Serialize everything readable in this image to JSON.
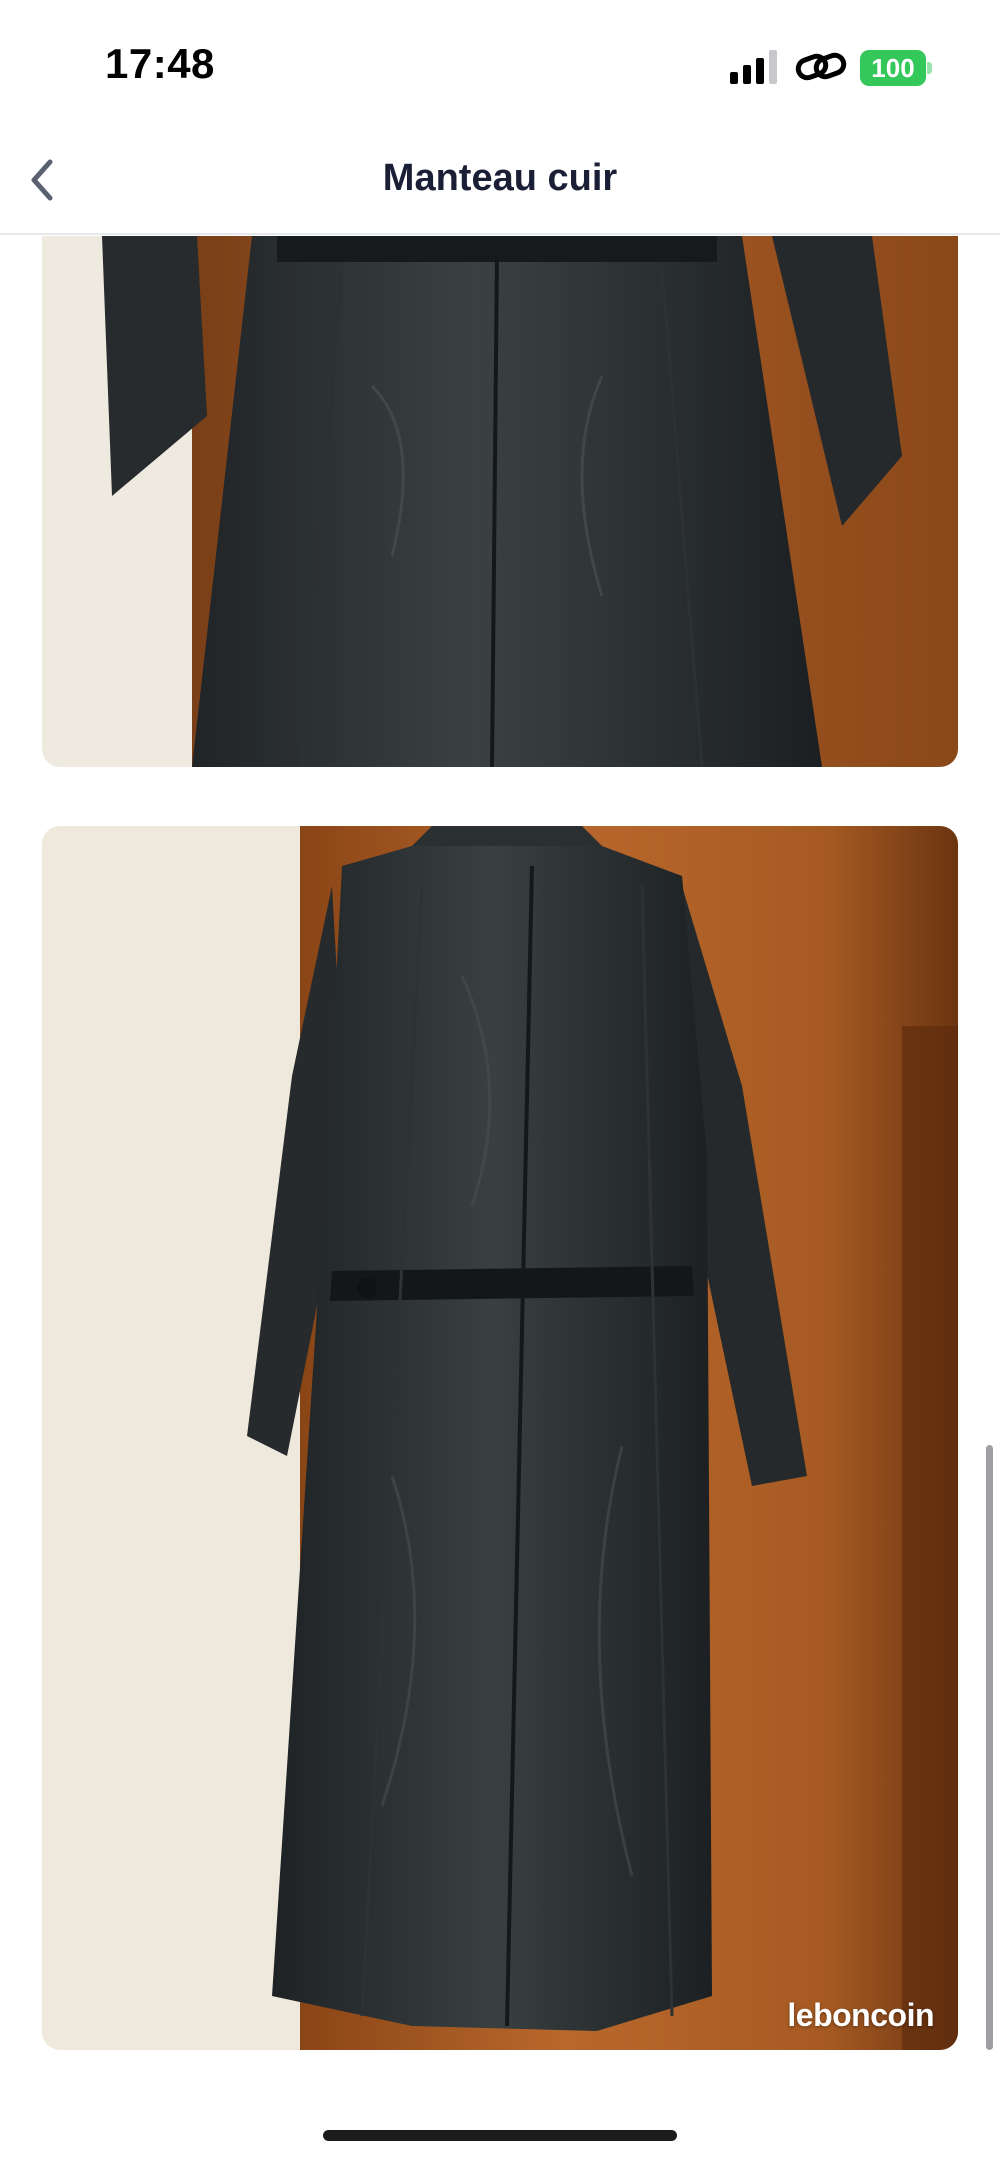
{
  "status_bar": {
    "time": "17:48",
    "battery": "100",
    "battery_color": "#34c759",
    "icons": [
      "signal-icon",
      "chain-link-icon",
      "battery-icon"
    ]
  },
  "header": {
    "title": "Manteau cuir",
    "back_icon": "chevron-left-icon"
  },
  "gallery": {
    "photos": [
      {
        "description_icon": "leather-coat-photo-front"
      },
      {
        "description_icon": "leather-coat-photo-back",
        "watermark": "leboncoin"
      }
    ]
  }
}
